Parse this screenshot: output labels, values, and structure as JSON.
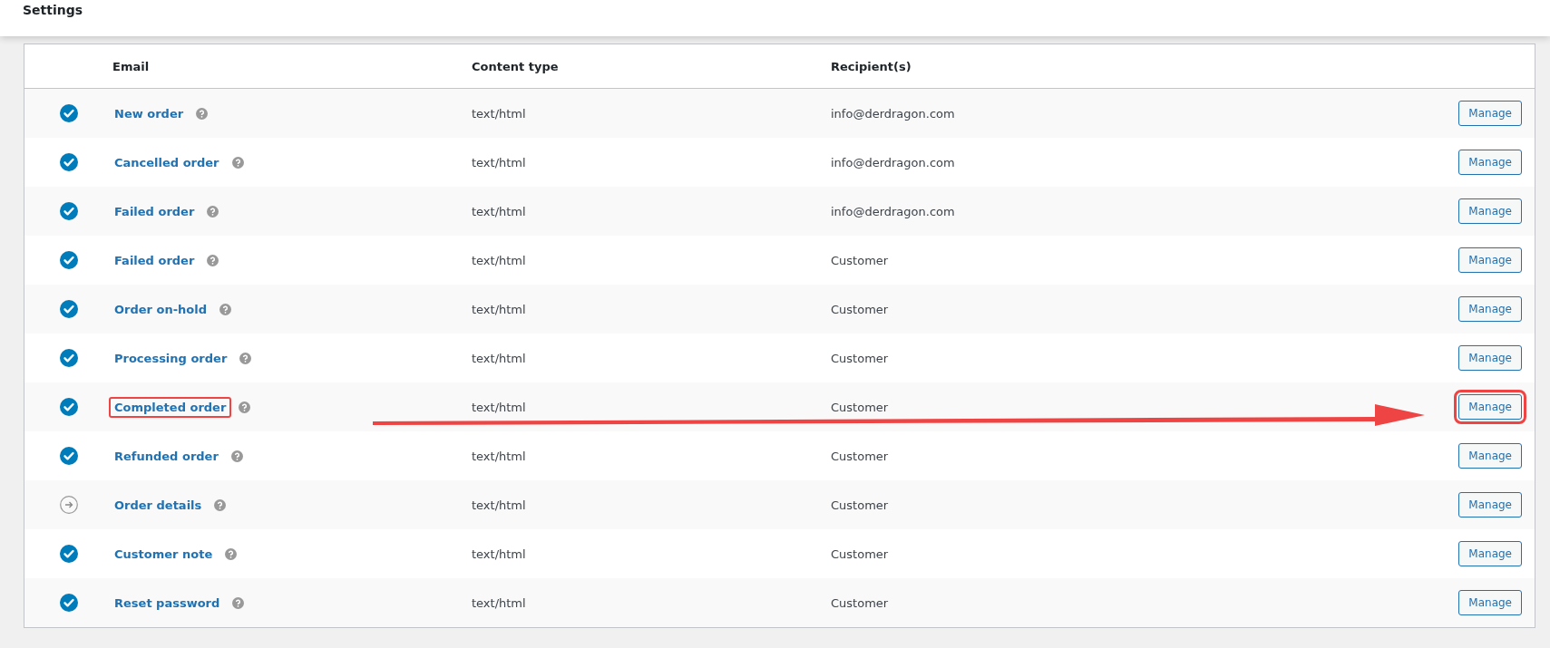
{
  "header": {
    "title": "Settings"
  },
  "table": {
    "columns": [
      "Email",
      "Content type",
      "Recipient(s)"
    ],
    "rows": [
      {
        "enabled": true,
        "name": "New order",
        "content_type": "text/html",
        "recipient": "info@derdragon.com",
        "action": "Manage",
        "highlighted": false
      },
      {
        "enabled": true,
        "name": "Cancelled order",
        "content_type": "text/html",
        "recipient": "info@derdragon.com",
        "action": "Manage",
        "highlighted": false
      },
      {
        "enabled": true,
        "name": "Failed order",
        "content_type": "text/html",
        "recipient": "info@derdragon.com",
        "action": "Manage",
        "highlighted": false
      },
      {
        "enabled": true,
        "name": "Failed order",
        "content_type": "text/html",
        "recipient": "Customer",
        "action": "Manage",
        "highlighted": false
      },
      {
        "enabled": true,
        "name": "Order on-hold",
        "content_type": "text/html",
        "recipient": "Customer",
        "action": "Manage",
        "highlighted": false
      },
      {
        "enabled": true,
        "name": "Processing order",
        "content_type": "text/html",
        "recipient": "Customer",
        "action": "Manage",
        "highlighted": false
      },
      {
        "enabled": true,
        "name": "Completed order",
        "content_type": "text/html",
        "recipient": "Customer",
        "action": "Manage",
        "highlighted": true
      },
      {
        "enabled": true,
        "name": "Refunded order",
        "content_type": "text/html",
        "recipient": "Customer",
        "action": "Manage",
        "highlighted": false
      },
      {
        "enabled": false,
        "name": "Order details",
        "content_type": "text/html",
        "recipient": "Customer",
        "action": "Manage",
        "highlighted": false
      },
      {
        "enabled": true,
        "name": "Customer note",
        "content_type": "text/html",
        "recipient": "Customer",
        "action": "Manage",
        "highlighted": false
      },
      {
        "enabled": true,
        "name": "Reset password",
        "content_type": "text/html",
        "recipient": "Customer",
        "action": "Manage",
        "highlighted": false
      }
    ]
  }
}
